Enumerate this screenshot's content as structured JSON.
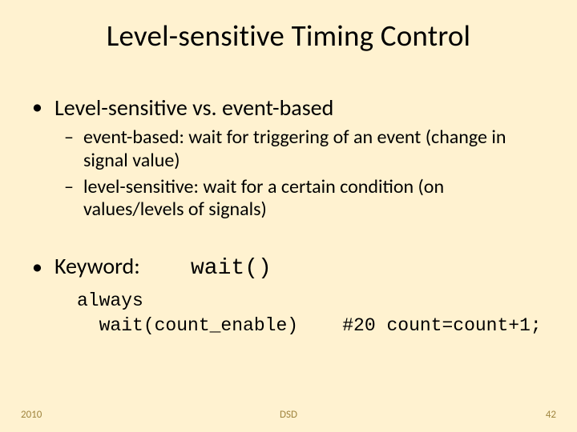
{
  "title": "Level-sensitive Timing Control",
  "bullets": {
    "b1": "Level-sensitive vs. event-based",
    "b1a": "event-based: wait for triggering of an event (change in signal value)",
    "b1b": "level-sensitive: wait for a certain condition (on values/levels of signals)",
    "b2_label": "Keyword:",
    "b2_code": "wait()"
  },
  "code": {
    "line1": "always",
    "line2": "  wait(count_enable)    #20 count=count+1;"
  },
  "footer": {
    "left": "2010",
    "center": "DSD",
    "right": "42"
  }
}
